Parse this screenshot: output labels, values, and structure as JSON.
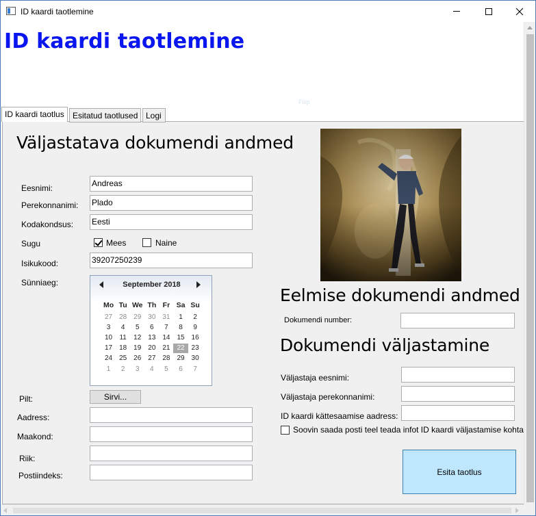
{
  "window": {
    "title": "ID kaardi taotlemine"
  },
  "header": {
    "heading": "ID kaardi taotlemine",
    "faint_label": "Filip"
  },
  "tabs": [
    {
      "label": "ID kaardi taotlus",
      "selected": true
    },
    {
      "label": "Esitatud taotlused",
      "selected": false
    },
    {
      "label": "Logi",
      "selected": false
    }
  ],
  "left": {
    "section_title": "Väljastatava dokumendi andmed",
    "labels": {
      "eesnimi": "Eesnimi:",
      "perekonnanimi": "Perekonnanimi:",
      "kodakondsus": "Kodakondsus:",
      "sugu": "Sugu",
      "isikukood": "Isikukood:",
      "sunniaeg": "Sünniaeg:",
      "pilt": "Pilt:",
      "aadress": "Aadress:",
      "maakond": "Maakond:",
      "riik": "Riik:",
      "postiindeks": "Postiindeks:"
    },
    "values": {
      "eesnimi": "Andreas",
      "perekonnanimi": "Plado",
      "kodakondsus": "Eesti",
      "isikukood": "39207250239",
      "aadress": "",
      "maakond": "",
      "riik": "",
      "postiindeks": ""
    },
    "gender": {
      "male_label": "Mees",
      "female_label": "Naine",
      "male_checked": true,
      "female_checked": false
    },
    "browse_button": "Sirvi..."
  },
  "calendar": {
    "month_label": "September 2018",
    "weekdays": [
      "Mo",
      "Tu",
      "We",
      "Th",
      "Fr",
      "Sa",
      "Su"
    ],
    "weeks": [
      [
        "27",
        "28",
        "29",
        "30",
        "31",
        "1",
        "2"
      ],
      [
        "3",
        "4",
        "5",
        "6",
        "7",
        "8",
        "9"
      ],
      [
        "10",
        "11",
        "12",
        "13",
        "14",
        "15",
        "16"
      ],
      [
        "17",
        "18",
        "19",
        "20",
        "21",
        "22",
        "23"
      ],
      [
        "24",
        "25",
        "26",
        "27",
        "28",
        "29",
        "30"
      ],
      [
        "1",
        "2",
        "3",
        "4",
        "5",
        "6",
        "7"
      ]
    ],
    "selected_day": "22"
  },
  "right": {
    "previous_title": "Eelmise dokumendi andmed",
    "document_number_label": "Dokumendi number:",
    "document_number_value": "",
    "issuance_title": "Dokumendi väljastamine",
    "issuer_first_label": "Väljastaja eesnimi:",
    "issuer_last_label": "Väljastaja perekonnanimi:",
    "pickup_address_label": "ID kaardi kättesaamise aadress:",
    "issuer_first_value": "",
    "issuer_last_value": "",
    "pickup_address_value": "",
    "notify_checkbox_label": "Soovin saada posti teel teada infot ID kaardi väljastamise kohta",
    "notify_checked": false,
    "submit_button": "Esita taotlus"
  },
  "colors": {
    "heading": "#0a16f0",
    "submit_button_bg": "#bee6fd",
    "panel_bg": "#f0f0f0"
  }
}
